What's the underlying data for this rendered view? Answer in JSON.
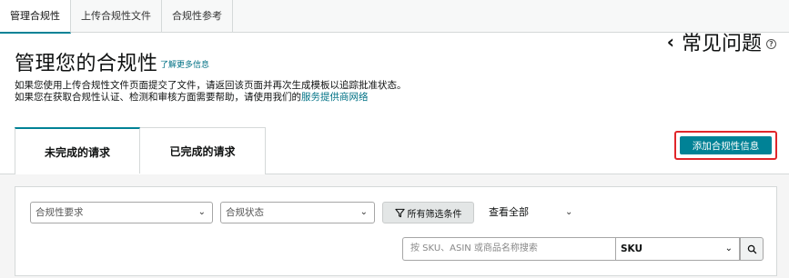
{
  "top_tabs": [
    {
      "label": "管理合规性",
      "active": true
    },
    {
      "label": "上传合规性文件",
      "active": false
    },
    {
      "label": "合规性参考",
      "active": false
    }
  ],
  "header": {
    "title": "管理您的合规性",
    "learn_more": "了解更多信息",
    "desc_line1": "如果您使用上传合规性文件页面提交了文件，请返回该页面并再次生成模板以追踪批准状态。",
    "desc_line2_prefix": "如果您在获取合规性认证、检测和审核方面需要帮助，请使用我们的",
    "desc_line2_link": "服务提供商网络"
  },
  "faq": {
    "label": "常见问题",
    "chevron_icon": "chevron-left-icon",
    "help_icon": "help-circle-icon"
  },
  "request_tabs": [
    {
      "label": "未完成的请求",
      "active": true
    },
    {
      "label": "已完成的请求",
      "active": false
    }
  ],
  "add_button": {
    "label": "添加合规性信息"
  },
  "filters": {
    "compliance_requirement": {
      "value": "合规性要求"
    },
    "compliance_status": {
      "value": "合规状态"
    },
    "all_filters_label": "所有筛选条件",
    "view_all_label": "查看全部"
  },
  "search": {
    "placeholder": "按 SKU、ASIN 或商品名称搜索",
    "field_select": "SKU"
  },
  "colors": {
    "accent": "#008296",
    "highlight_border": "#e0262a"
  }
}
